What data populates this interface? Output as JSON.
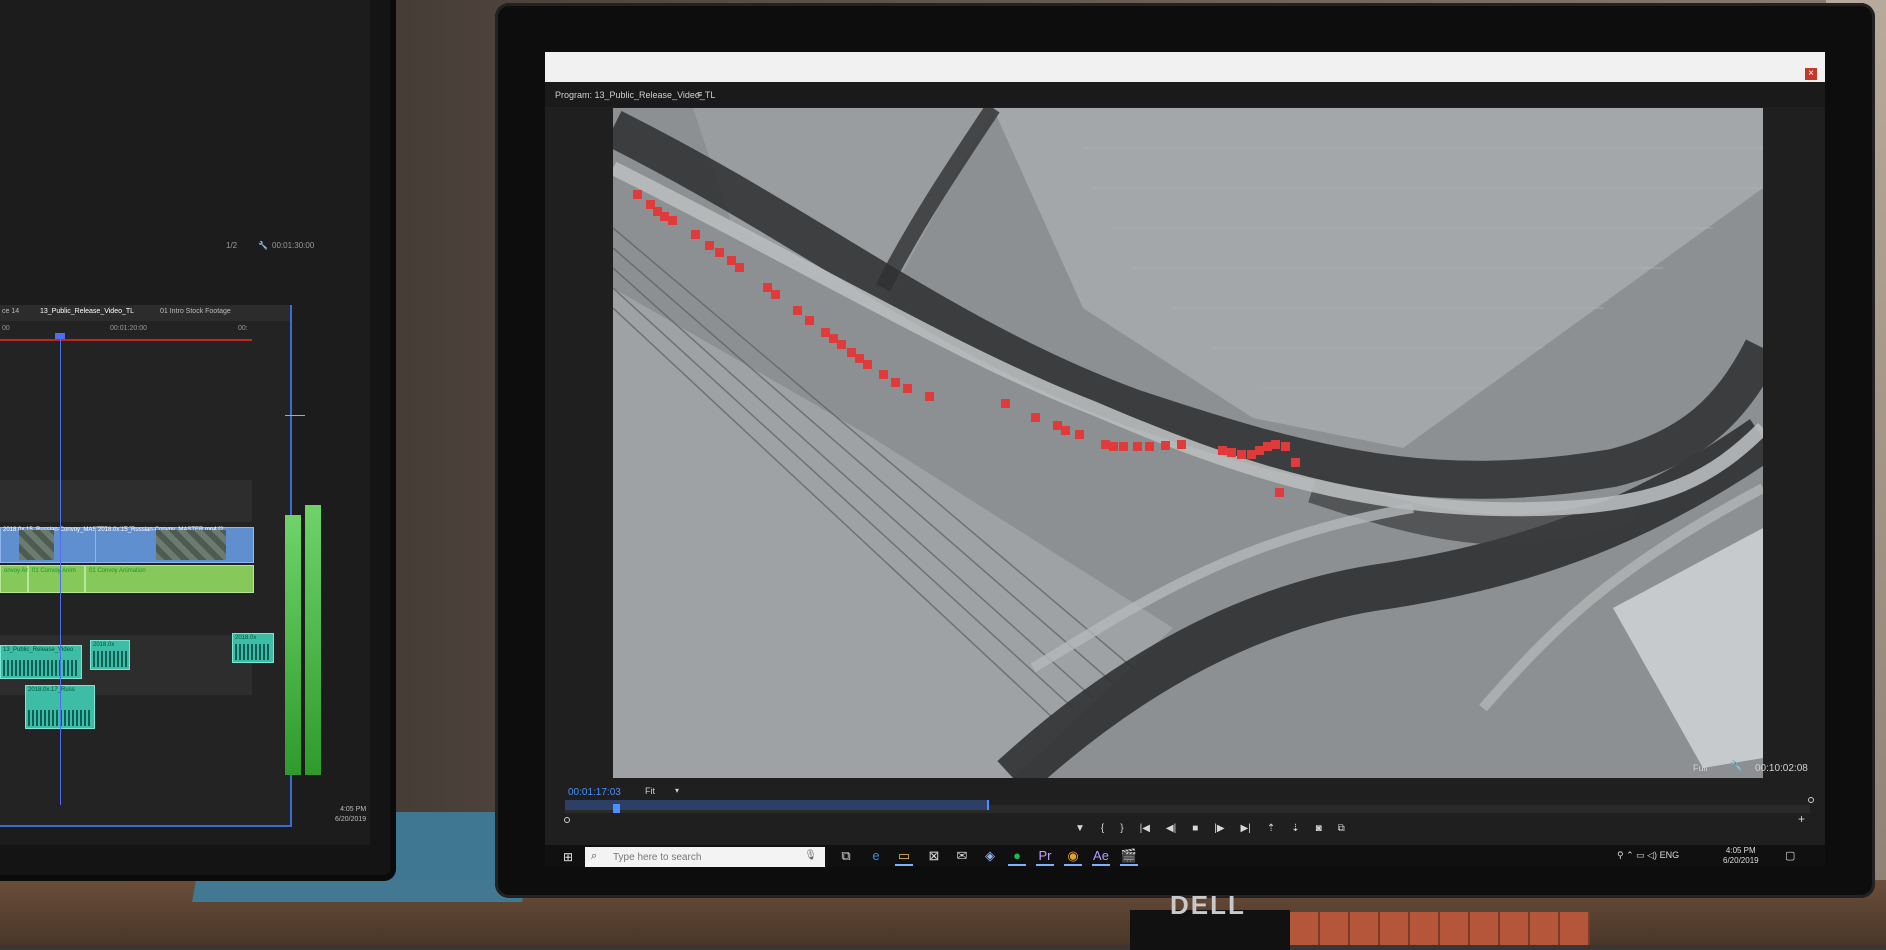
{
  "left_panel": {
    "page_fraction": "1/2",
    "top_timecode": "00:01:30:00",
    "tabs": [
      "ce 14",
      "13_Public_Release_Video_TL",
      "01 Intro Stock Footage"
    ],
    "ruler": [
      "00",
      "00:01:20:00",
      "00:"
    ],
    "clips": {
      "video_a": "2018.0x.15_Russian-Convoy_MASTER.mp4 [30]",
      "video_b": "2018.0x.15_Russian-Convoy_MASTER.mp4 [2",
      "graphic_a": "onvoy Ani",
      "graphic_b": "01 Convoy Anim",
      "graphic_c": "01 Convoy Animation",
      "audio_a": "13_Public_Release_Video",
      "audio_b": "2018.0x",
      "audio_c": "2018.0x.17_Russ",
      "audio_d": "2018.0x"
    },
    "clock_time": "4:05 PM",
    "clock_date": "6/20/2019"
  },
  "program_panel": {
    "title": "Program: 13_Public_Release_Video_TL",
    "menu_icon": "≡",
    "close": "×",
    "timecode_current": "00:01:17:03",
    "fit_label": "Fit",
    "full_label": "Full",
    "timecode_duration": "00:10:02:08"
  },
  "transport": {
    "marker": "▼",
    "mark_in": "{",
    "mark_out": "}",
    "go_to_in": "|◀",
    "step_back": "◀|",
    "stop": "■",
    "step_forward": "|▶",
    "go_to_out": "▶|",
    "lift": "⇡",
    "extract": "⇣",
    "export_frame": "◙",
    "compare": "⧉",
    "add": "+"
  },
  "taskbar": {
    "search_placeholder": "Type here to search",
    "tray_language": "ENG",
    "clock_time": "4:05 PM",
    "clock_date": "6/20/2019"
  },
  "brand": {
    "monitor_logo": "DELL"
  },
  "colors": {
    "accent_blue": "#4a90ff",
    "marker_red": "#e03a3a",
    "clip_blue": "#5f8fcf",
    "clip_green": "#86c95a",
    "clip_teal": "#3ebda6"
  }
}
